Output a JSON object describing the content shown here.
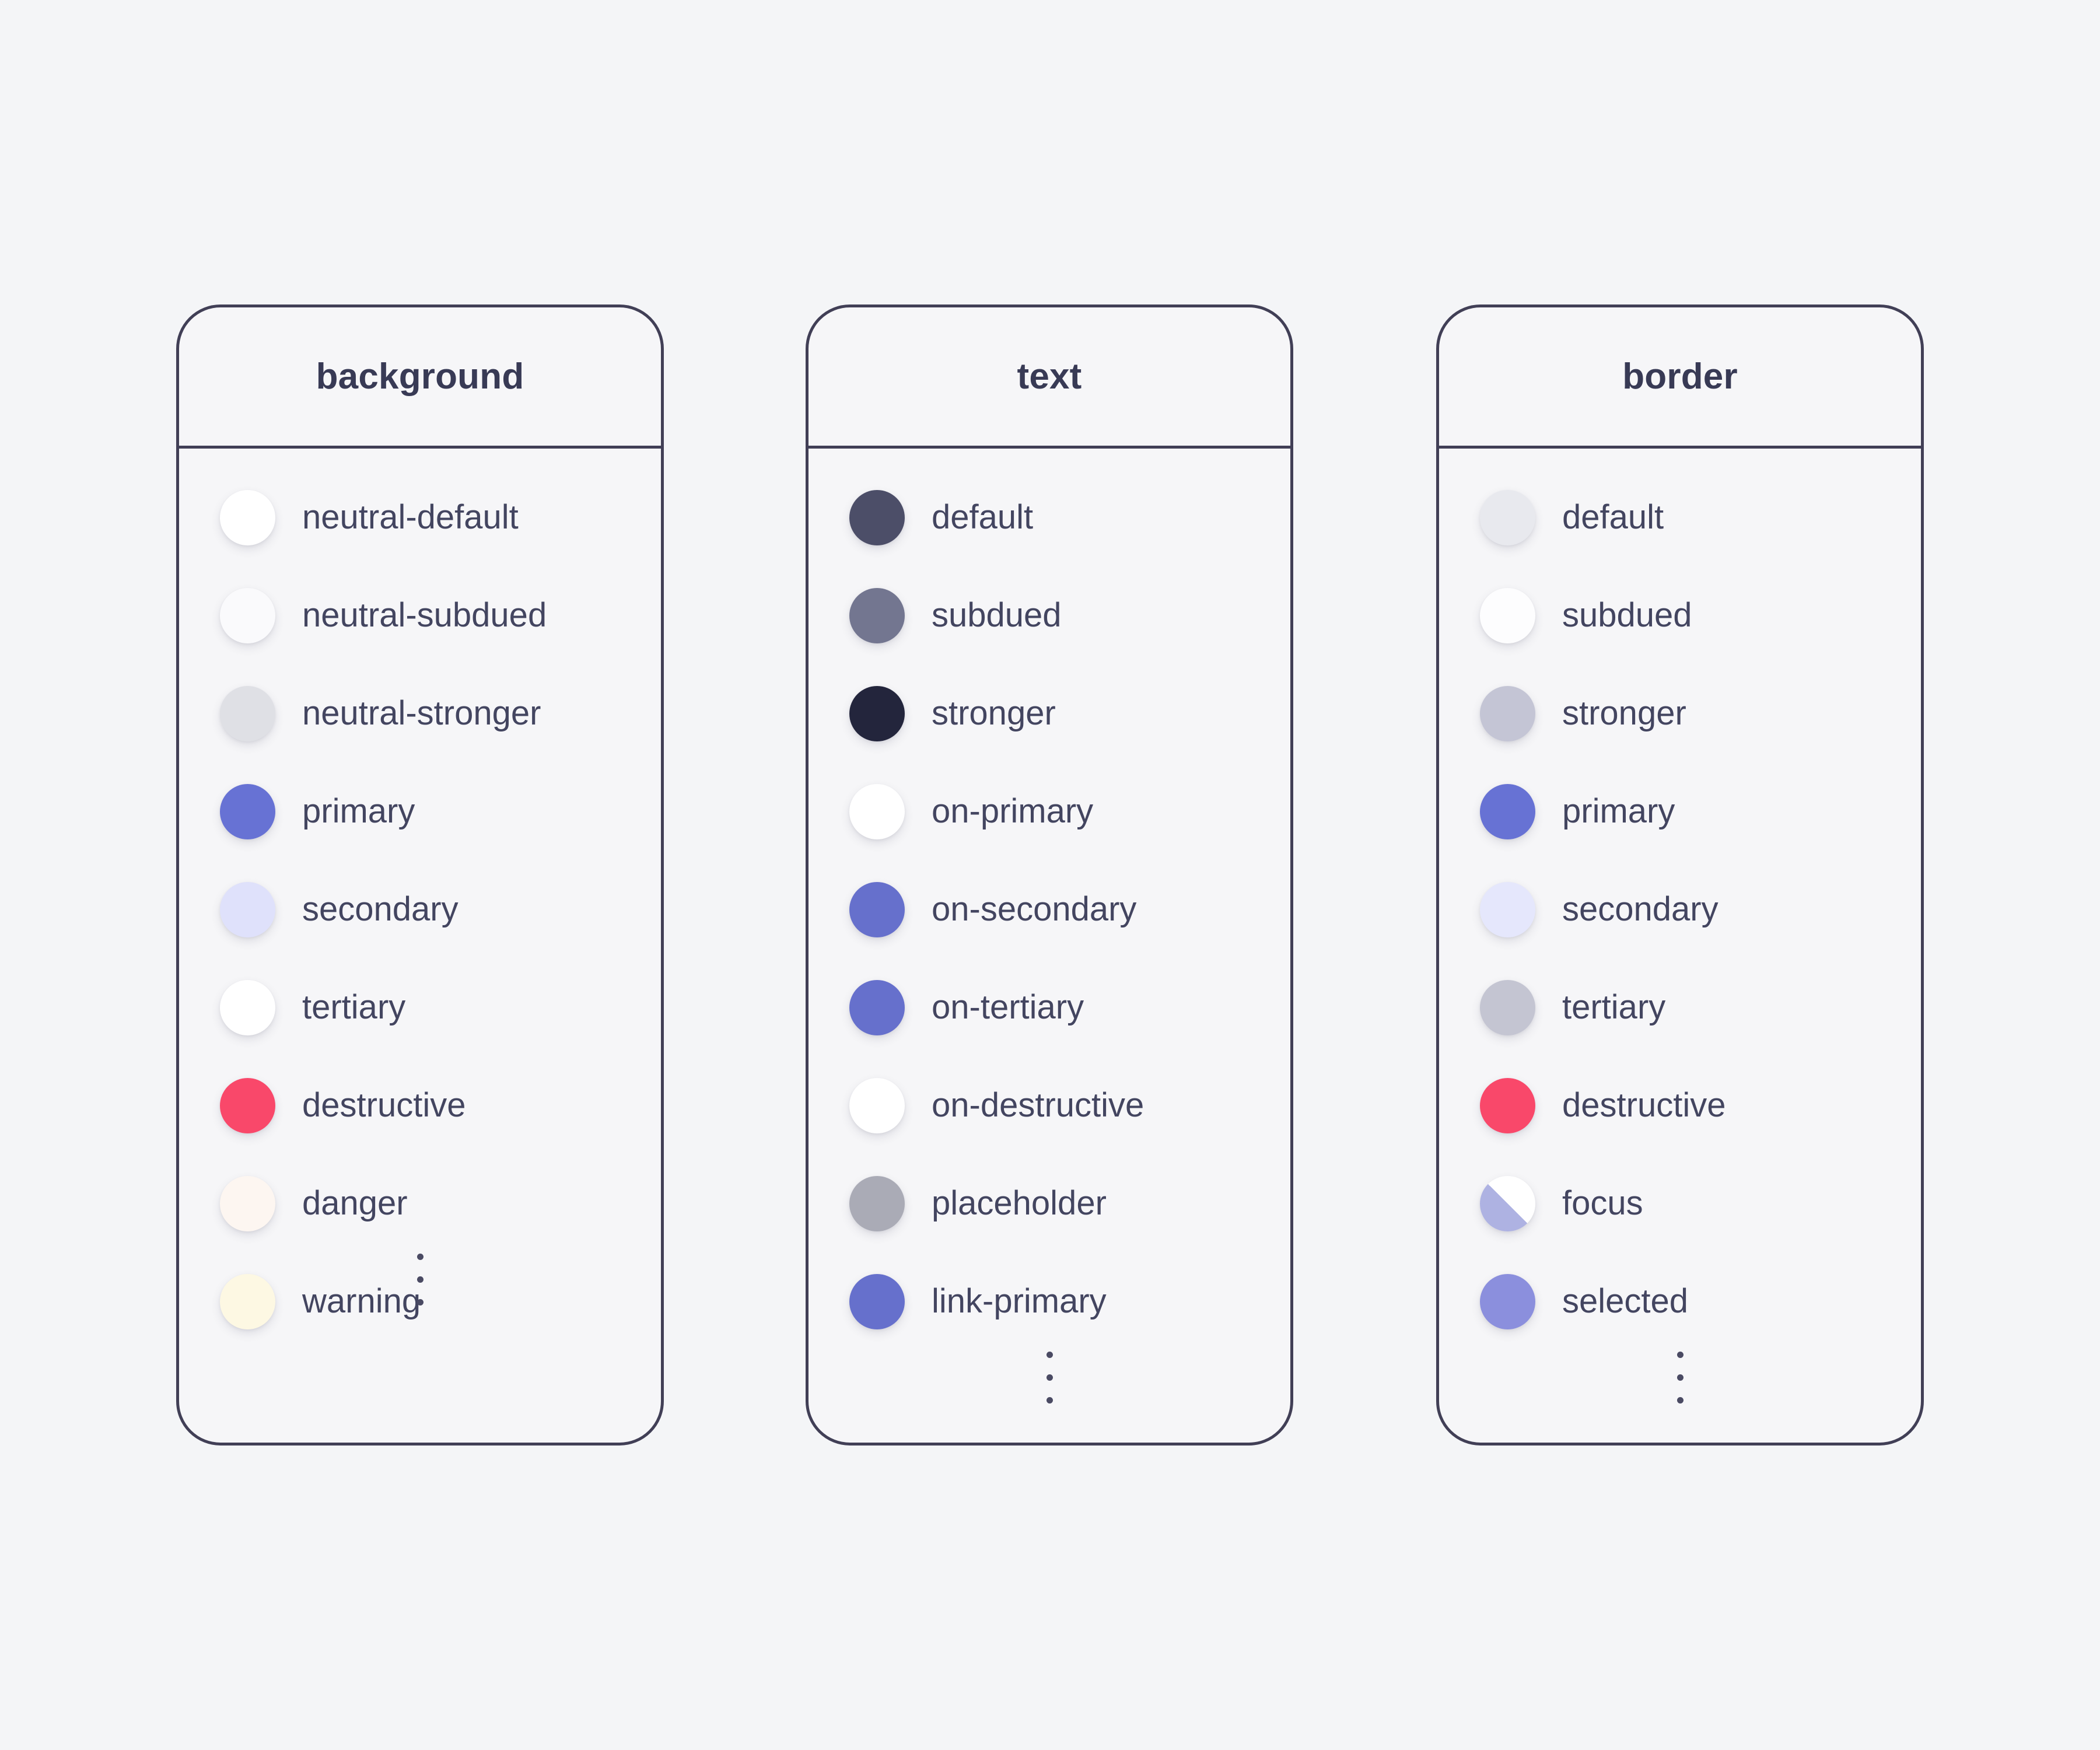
{
  "page": {
    "canvas_background": "#f4f5f7",
    "card_background": "#f6f6f8",
    "card_border_color": "#413f56",
    "label_color": "#434560",
    "title_color": "#383a55",
    "ellipsis_glyph": "vertical-ellipsis"
  },
  "cards": [
    {
      "title": "background",
      "tokens": [
        {
          "label": "neutral-default",
          "color": "#ffffff"
        },
        {
          "label": "neutral-subdued",
          "color": "#fafafc"
        },
        {
          "label": "neutral-stronger",
          "color": "#dfe0e5"
        },
        {
          "label": "primary",
          "color": "#6772d4"
        },
        {
          "label": "secondary",
          "color": "#dfe1fb"
        },
        {
          "label": "tertiary",
          "color": "#ffffff"
        },
        {
          "label": "destructive",
          "color": "#f9486a"
        },
        {
          "label": "danger",
          "color": "#fdf6f1"
        },
        {
          "label": "warning",
          "color": "#fdf8e3"
        }
      ],
      "truncated": true
    },
    {
      "title": "text",
      "tokens": [
        {
          "label": "default",
          "color": "#4c4e68"
        },
        {
          "label": "subdued",
          "color": "#737690"
        },
        {
          "label": "stronger",
          "color": "#23253c"
        },
        {
          "label": "on-primary",
          "color": "#ffffff"
        },
        {
          "label": "on-secondary",
          "color": "#6670cc"
        },
        {
          "label": "on-tertiary",
          "color": "#6670cc"
        },
        {
          "label": "on-destructive",
          "color": "#ffffff"
        },
        {
          "label": "placeholder",
          "color": "#aaabb6"
        },
        {
          "label": "link-primary",
          "color": "#6670cc"
        }
      ],
      "truncated": true
    },
    {
      "title": "border",
      "tokens": [
        {
          "label": "default",
          "color": "#e8e9ee"
        },
        {
          "label": "subdued",
          "color": "#fdfdfe"
        },
        {
          "label": "stronger",
          "color": "#c4c5d5"
        },
        {
          "label": "primary",
          "color": "#6772d4"
        },
        {
          "label": "secondary",
          "color": "#e5e7fc"
        },
        {
          "label": "tertiary",
          "color": "#c4c5d2"
        },
        {
          "label": "destructive",
          "color": "#f9486a"
        },
        {
          "label": "focus",
          "color": "#aeb2e2",
          "color_secondary": "#ffffff",
          "split": "diagonal"
        },
        {
          "label": "selected",
          "color": "#8b8fdd"
        }
      ],
      "truncated": true
    }
  ]
}
